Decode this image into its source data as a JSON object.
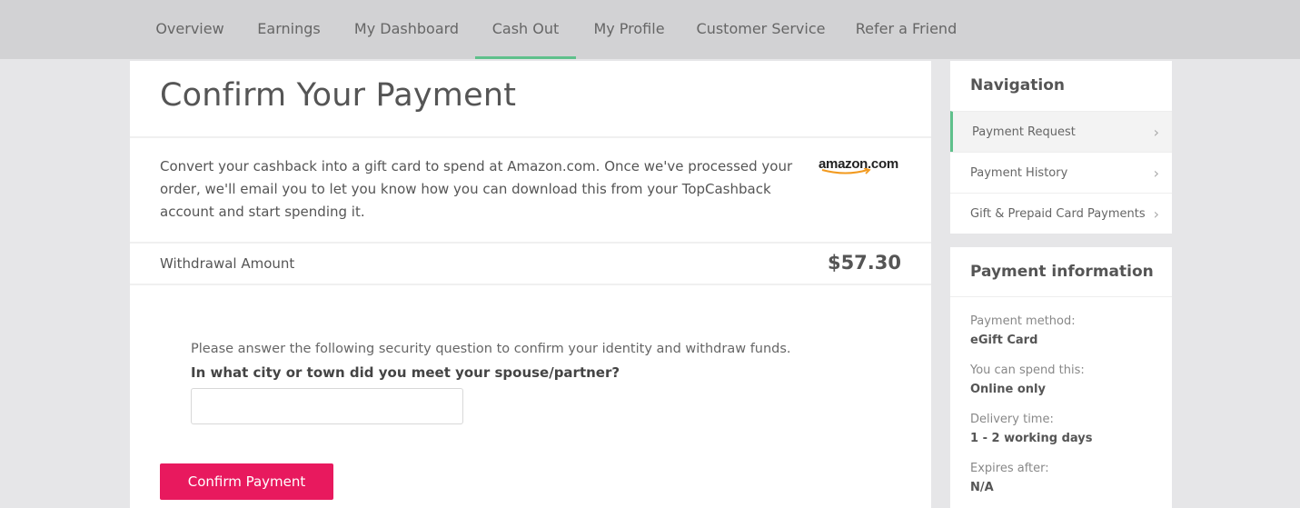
{
  "nav": {
    "tabs": [
      {
        "label": "Overview"
      },
      {
        "label": "Earnings"
      },
      {
        "label": "My Dashboard"
      },
      {
        "label": "Cash Out",
        "active": true
      },
      {
        "label": "My Profile"
      },
      {
        "label": "Customer Service"
      },
      {
        "label": "Refer a Friend"
      }
    ]
  },
  "main": {
    "title": "Confirm Your Payment",
    "description": "Convert your cashback into a gift card to spend at Amazon.com. Once we've processed your order, we'll email you to let you know how you can download this from your TopCashback account and start spending it.",
    "logo_text": "amazon.com",
    "withdrawal_label": "Withdrawal Amount",
    "withdrawal_amount": "$57.30",
    "security_text": "Please answer the following security question to confirm your identity and withdraw funds.",
    "security_question": "In what city or town did you meet your spouse/partner?",
    "answer_value": "",
    "confirm_label": "Confirm Payment"
  },
  "sidebar": {
    "nav_title": "Navigation",
    "nav_items": [
      {
        "label": "Payment Request",
        "active": true
      },
      {
        "label": "Payment History"
      },
      {
        "label": "Gift & Prepaid Card Payments"
      }
    ],
    "info_title": "Payment information",
    "info": [
      {
        "label": "Payment method:",
        "value": "eGift Card"
      },
      {
        "label": "You can spend this:",
        "value": "Online only"
      },
      {
        "label": "Delivery time:",
        "value": "1 - 2 working days"
      },
      {
        "label": "Expires after:",
        "value": "N/A"
      }
    ]
  },
  "colors": {
    "accent_green": "#5fc08b",
    "confirm_button": "#e8195e",
    "nav_bar": "#d2d2d4",
    "page_bg": "#e6e6e8"
  },
  "icons": {
    "chevron": "chevron-right-icon",
    "logo": "amazon-logo"
  }
}
